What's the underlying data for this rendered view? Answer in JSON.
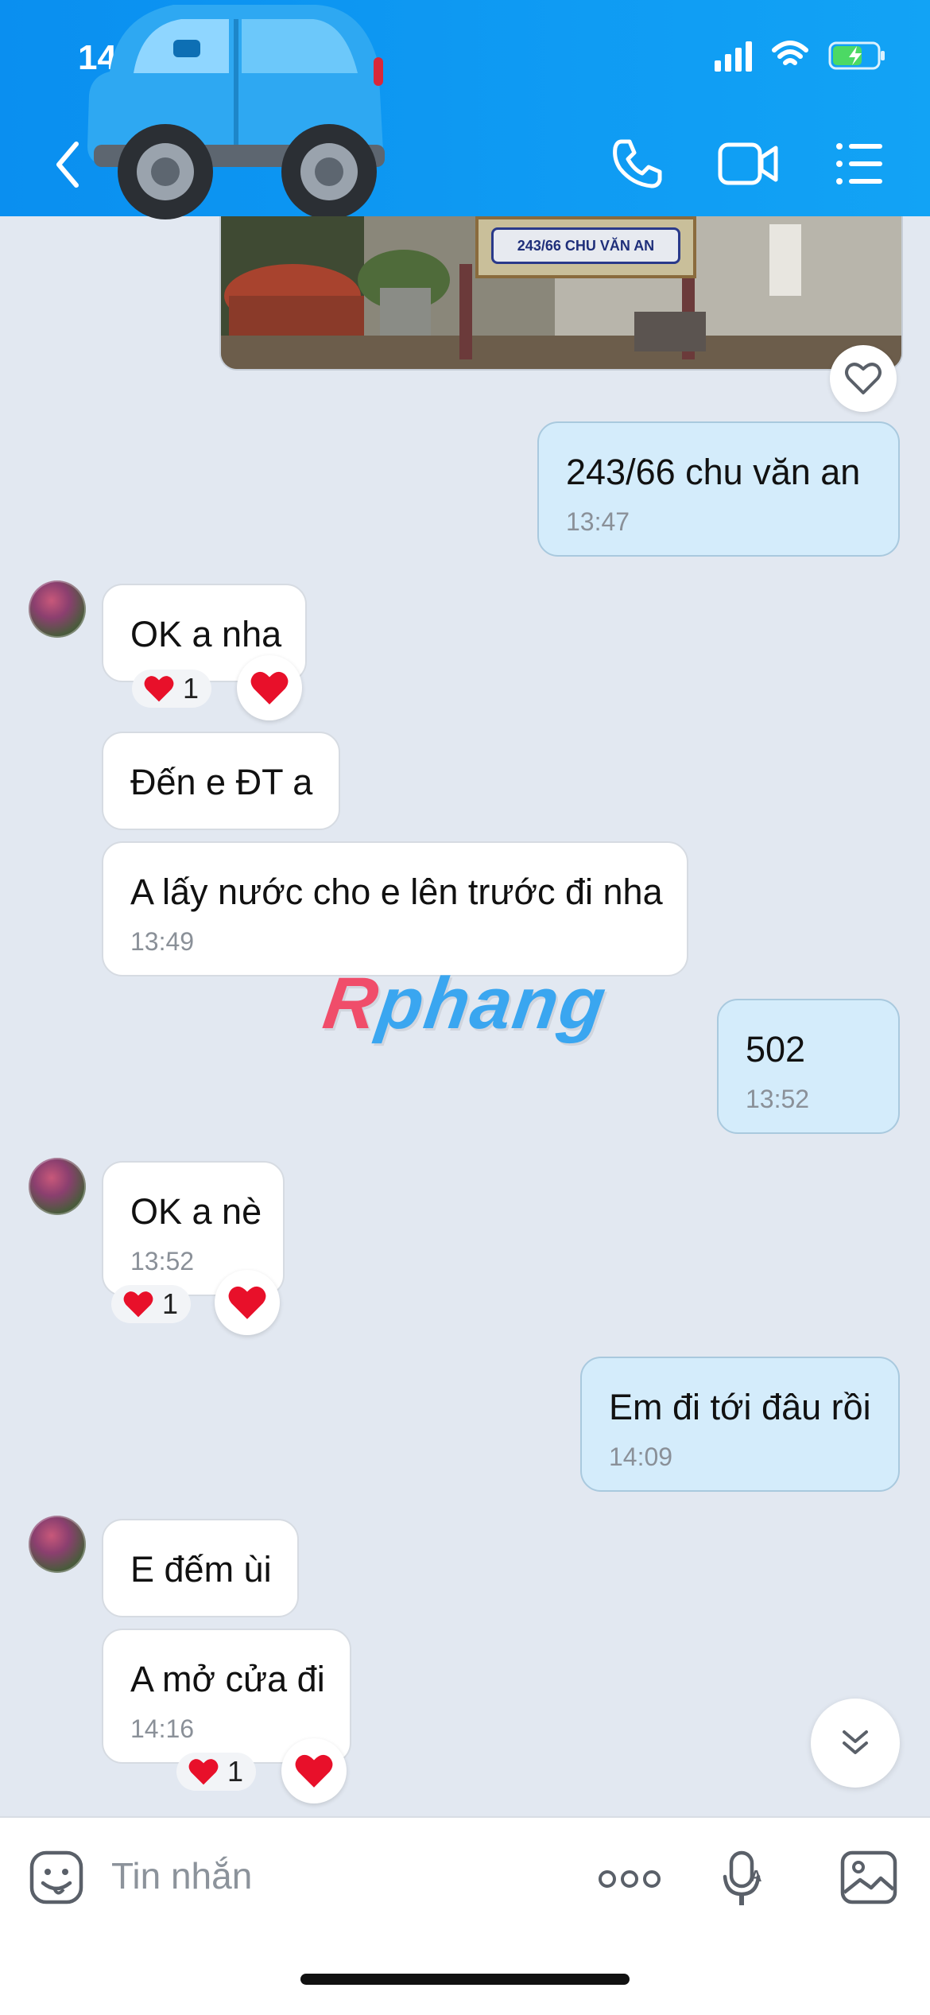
{
  "status_bar": {
    "time": "14:2"
  },
  "header": {
    "back_icon": "chevron-left-icon",
    "call_icon": "phone-icon",
    "video_icon": "video-camera-icon",
    "menu_icon": "list-menu-icon",
    "sticker": "car-emoji"
  },
  "photo_message": {
    "sign_text": "243/66 CHU VĂN AN"
  },
  "messages": [
    {
      "id": "m1",
      "dir": "out",
      "text": "243/66 chu văn an",
      "time": "13:47"
    },
    {
      "id": "m2",
      "dir": "in",
      "text": "OK a nha",
      "reaction_count": "1"
    },
    {
      "id": "m3",
      "dir": "in",
      "text": "Đến e ĐT a"
    },
    {
      "id": "m4",
      "dir": "in",
      "text": "A lấy nước cho e lên trước đi nha",
      "time": "13:49"
    },
    {
      "id": "m5",
      "dir": "out",
      "text": "502",
      "time": "13:52"
    },
    {
      "id": "m6",
      "dir": "in",
      "text": "OK a nè",
      "time": "13:52",
      "reaction_count": "1"
    },
    {
      "id": "m7",
      "dir": "out",
      "text": "Em đi tới đâu rồi",
      "time": "14:09"
    },
    {
      "id": "m8",
      "dir": "in",
      "text": "E đếm ùi"
    },
    {
      "id": "m9",
      "dir": "in",
      "text": "A mở cửa đi",
      "time": "14:16",
      "reaction_count": "1"
    }
  ],
  "watermark": {
    "first": "R",
    "rest": "phang"
  },
  "input_bar": {
    "placeholder": "Tin nhắn",
    "icons": [
      "sticker-icon",
      "more-icon",
      "voice-to-text-icon",
      "image-icon"
    ]
  },
  "colors": {
    "header": "#0a8ff0",
    "outgoing_bubble": "#d4ecfb",
    "incoming_bubble": "#ffffff",
    "background": "#e2e8f1",
    "reaction_heart": "#e8102a"
  }
}
